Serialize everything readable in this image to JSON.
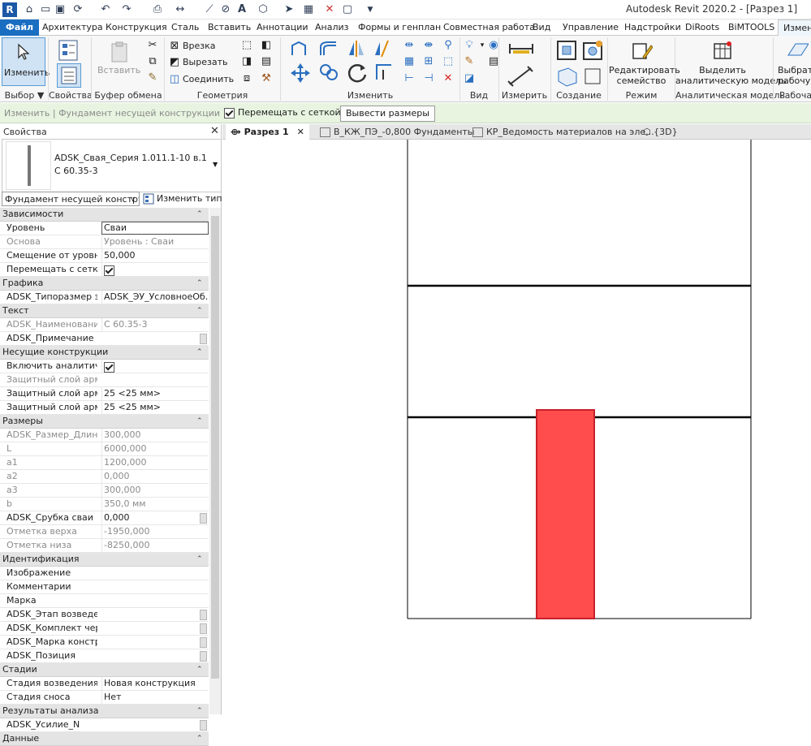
{
  "app": {
    "logo_letter": "R",
    "title": "Autodesk Revit 2020.2 - [Разрез 1]"
  },
  "ribbon_tabs": {
    "file": "Файл",
    "items": [
      "Архитектура",
      "Конструкция",
      "Сталь",
      "Вставить",
      "Аннотации",
      "Анализ",
      "Формы и генплан",
      "Совместная работа",
      "Вид",
      "Управление",
      "Надстройки",
      "DiRoots",
      "BiMTOOLS"
    ],
    "active": "Изменить | Фундамент несущей конструкции"
  },
  "ribbon": {
    "select": {
      "modify_label": "Изменить",
      "dropdown": "Выбор ▼"
    },
    "properties": {
      "label": "Свойства"
    },
    "clipboard": {
      "paste_label": "Вставить",
      "title": "Буфер обмена"
    },
    "geometry": {
      "cut": "Врезка",
      "trim": "Вырезать",
      "join": "Соединить",
      "title": "Геометрия"
    },
    "modify": {
      "title": "Изменить"
    },
    "view": {
      "title": "Вид"
    },
    "measure": {
      "title": "Измерить"
    },
    "create": {
      "title": "Создание"
    },
    "mode": {
      "edit_family_l1": "Редактировать",
      "edit_family_l2": "семейство",
      "title": "Режим"
    },
    "analytical": {
      "l1": "Выделить",
      "l2": "аналитическую модель",
      "title": "Аналитическая модель"
    },
    "workplane": {
      "l1": "Выбрать",
      "l2": "рабочую",
      "title": "Рабочая"
    }
  },
  "options_bar": {
    "context": "Изменить | Фундамент несущей конструкции",
    "move_with_grid": "Перемещать с сеткой",
    "move_with_grid_checked": true,
    "show_dims_button": "Вывести размеры"
  },
  "properties": {
    "title": "Свойства",
    "type_name_line1": "ADSK_Свая_Серия 1.011.1-10 в.1",
    "type_name_line2": "С 60.35-3",
    "instance_filter": "Фундамент несущей конструкц",
    "edit_type": "Изменить тип",
    "rows": [
      {
        "kind": "group",
        "name": "Зависимости"
      },
      {
        "kind": "row",
        "name": "Уровень",
        "value": "Сваи",
        "selected": true
      },
      {
        "kind": "row",
        "name": "Основа",
        "value": "Уровень : Сваи",
        "readonly": true
      },
      {
        "kind": "row",
        "name": "Смещение от уровня",
        "value": "50,000"
      },
      {
        "kind": "check",
        "name": "Перемещать с сеткой",
        "checked": true
      },
      {
        "kind": "group",
        "name": "Графика"
      },
      {
        "kind": "row",
        "name": "ADSK_Типоразмер эл...",
        "value": "ADSK_ЭУ_УсловноеОб..."
      },
      {
        "kind": "group",
        "name": "Текст"
      },
      {
        "kind": "row",
        "name": "ADSK_Наименование",
        "value": "С 60.35-3",
        "readonly": true
      },
      {
        "kind": "row",
        "name": "ADSK_Примечание",
        "value": "",
        "edit": true
      },
      {
        "kind": "group",
        "name": "Несущие конструкции"
      },
      {
        "kind": "check",
        "name": "Включить аналитиче...",
        "checked": true
      },
      {
        "kind": "row",
        "name": "Защитный слой арма...",
        "value": "",
        "readonly": true
      },
      {
        "kind": "row",
        "name": "Защитный слой арма...",
        "value": "25 <25 мм>"
      },
      {
        "kind": "row",
        "name": "Защитный слой арма...",
        "value": "25 <25 мм>"
      },
      {
        "kind": "group",
        "name": "Размеры"
      },
      {
        "kind": "row",
        "name": "ADSK_Размер_Длина",
        "value": "300,000",
        "readonly": true
      },
      {
        "kind": "row",
        "name": "L",
        "value": "6000,000",
        "readonly": true
      },
      {
        "kind": "row",
        "name": "a1",
        "value": "1200,000",
        "readonly": true
      },
      {
        "kind": "row",
        "name": "a2",
        "value": "0,000",
        "readonly": true
      },
      {
        "kind": "row",
        "name": "a3",
        "value": "300,000",
        "readonly": true
      },
      {
        "kind": "row",
        "name": "b",
        "value": "350,0 мм",
        "readonly": true
      },
      {
        "kind": "row",
        "name": "ADSK_Срубка сваи",
        "value": "0,000",
        "edit": true
      },
      {
        "kind": "row",
        "name": "Отметка верха",
        "value": "-1950,000",
        "readonly": true
      },
      {
        "kind": "row",
        "name": "Отметка низа",
        "value": "-8250,000",
        "readonly": true
      },
      {
        "kind": "group",
        "name": "Идентификация"
      },
      {
        "kind": "row",
        "name": "Изображение",
        "value": ""
      },
      {
        "kind": "row",
        "name": "Комментарии",
        "value": ""
      },
      {
        "kind": "row",
        "name": "Марка",
        "value": ""
      },
      {
        "kind": "row",
        "name": "ADSK_Этап возведения",
        "value": "",
        "edit": true
      },
      {
        "kind": "row",
        "name": "ADSK_Комплект черт...",
        "value": "",
        "edit": true
      },
      {
        "kind": "row",
        "name": "ADSK_Марка констру...",
        "value": "",
        "edit": true
      },
      {
        "kind": "row",
        "name": "ADSK_Позиция",
        "value": "",
        "edit": true
      },
      {
        "kind": "group",
        "name": "Стадии"
      },
      {
        "kind": "row",
        "name": "Стадия возведения",
        "value": "Новая конструкция"
      },
      {
        "kind": "row",
        "name": "Стадия сноса",
        "value": "Нет"
      },
      {
        "kind": "group",
        "name": "Результаты анализа"
      },
      {
        "kind": "row",
        "name": "ADSK_Усилие_N",
        "value": "",
        "edit": true
      },
      {
        "kind": "group",
        "name": "Данные"
      }
    ]
  },
  "view_tabs": [
    {
      "label": "Разрез 1",
      "active": true
    },
    {
      "label": "В_КЖ_ПЭ_-0,800 Фундаменты",
      "active": false
    },
    {
      "label": "КР_Ведомость материалов на эле...",
      "active": false
    },
    {
      "label": "{3D}",
      "active": false
    }
  ],
  "colors": {
    "pile_fill": "#ff4c4c",
    "pile_stroke": "#c8202a",
    "file_tab": "#1a6ec1",
    "options_bar": "#e8f4e0"
  }
}
